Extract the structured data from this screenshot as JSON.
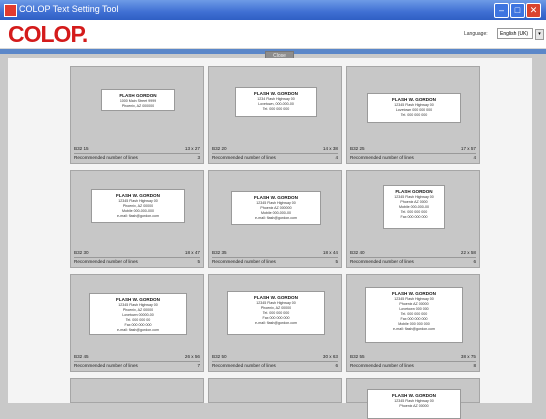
{
  "window": {
    "title": "COLOP Text Setting Tool",
    "min": "–",
    "max": "□",
    "close": "✕"
  },
  "app": {
    "logo": "COLOP.",
    "language_label": "Language:",
    "language_value": "English (UK)",
    "toolbar_button": "Close"
  },
  "rec_label": "Recommended number of lines",
  "tiles": [
    {
      "code": "B32 15",
      "size": "13 x 27",
      "lines": "3",
      "card": [
        "FLASH GORDON",
        "1000 Main Street 9999",
        "Phoenix, AZ 000000"
      ]
    },
    {
      "code": "B32 20",
      "size": "14 x 38",
      "lines": "4",
      "card": [
        "FLASH W. GORDON",
        "1234 Flash Highway 00",
        "Lovetown, 000-000-00",
        "Tel. 000 000 000"
      ]
    },
    {
      "code": "B32 25",
      "size": "17 x 57",
      "lines": "4",
      "card": [
        "FLASH W. GORDON",
        "12345 Flash Highway 00",
        "Lovetown 000 000 000",
        "Tel. 000 000 000"
      ]
    },
    {
      "code": "B32 30",
      "size": "18 x 47",
      "lines": "5",
      "card": [
        "FLASH W. GORDON",
        "12345 Flash Highway 00",
        "Phoenix, AZ 00000",
        "Mobile 000-000-000",
        "e-mail: flash@gordon.com"
      ]
    },
    {
      "code": "B32 35",
      "size": "18 x 44",
      "lines": "5",
      "card": [
        "FLASH W. GORDON",
        "12345 Flash Highway 00",
        "Phoenix AZ 000000",
        "Mobile 000-000-00",
        "e-mail: flash@gordon.com"
      ]
    },
    {
      "code": "B32 40",
      "size": "22 x 58",
      "lines": "6",
      "card": [
        "FLASH GORDON",
        "12345 Flash Highway 00",
        "Phoenix AZ 0000",
        "Mobile 000-000-00",
        "Tel. 000 000 000",
        "Fax 000 000 000"
      ]
    },
    {
      "code": "B32 45",
      "size": "26 x 56",
      "lines": "7",
      "card": [
        "FLASH W. GORDON",
        "12345 Flash Highway 00",
        "Phoenix, AZ 00000",
        "Lovetown 00000-00",
        "Tel. 000 000 00",
        "Fax 000 000 000",
        "e-mail: flash@gordon.com"
      ]
    },
    {
      "code": "B32 50",
      "size": "30 x 63",
      "lines": "6",
      "card": [
        "FLASH W. GORDON",
        "12345 Flash Highway 00",
        "Phoenix, AZ 00000",
        "Tel. 000 000 000",
        "Fax 000 000 000",
        "e-mail: flash@gordon.com"
      ]
    },
    {
      "code": "B32 55",
      "size": "38 x 75",
      "lines": "8",
      "card": [
        "FLASH W. GORDON",
        "12345 Flash Highway 00",
        "Phoenix AZ 00000",
        "Lovetown 000 000",
        "Tel. 000 000 000",
        "Fax 000 000 000",
        "Mobile 000 000 000",
        "e-mail: flash@gordon.com"
      ]
    },
    {
      "code": "",
      "size": "",
      "lines": "",
      "card": []
    },
    {
      "code": "",
      "size": "",
      "lines": "",
      "card": []
    },
    {
      "code": "",
      "size": "",
      "lines": "",
      "card": [
        "FLASH W. GORDON",
        "12345 Flash Highway 00",
        "Phoenix AZ 00000"
      ]
    }
  ]
}
